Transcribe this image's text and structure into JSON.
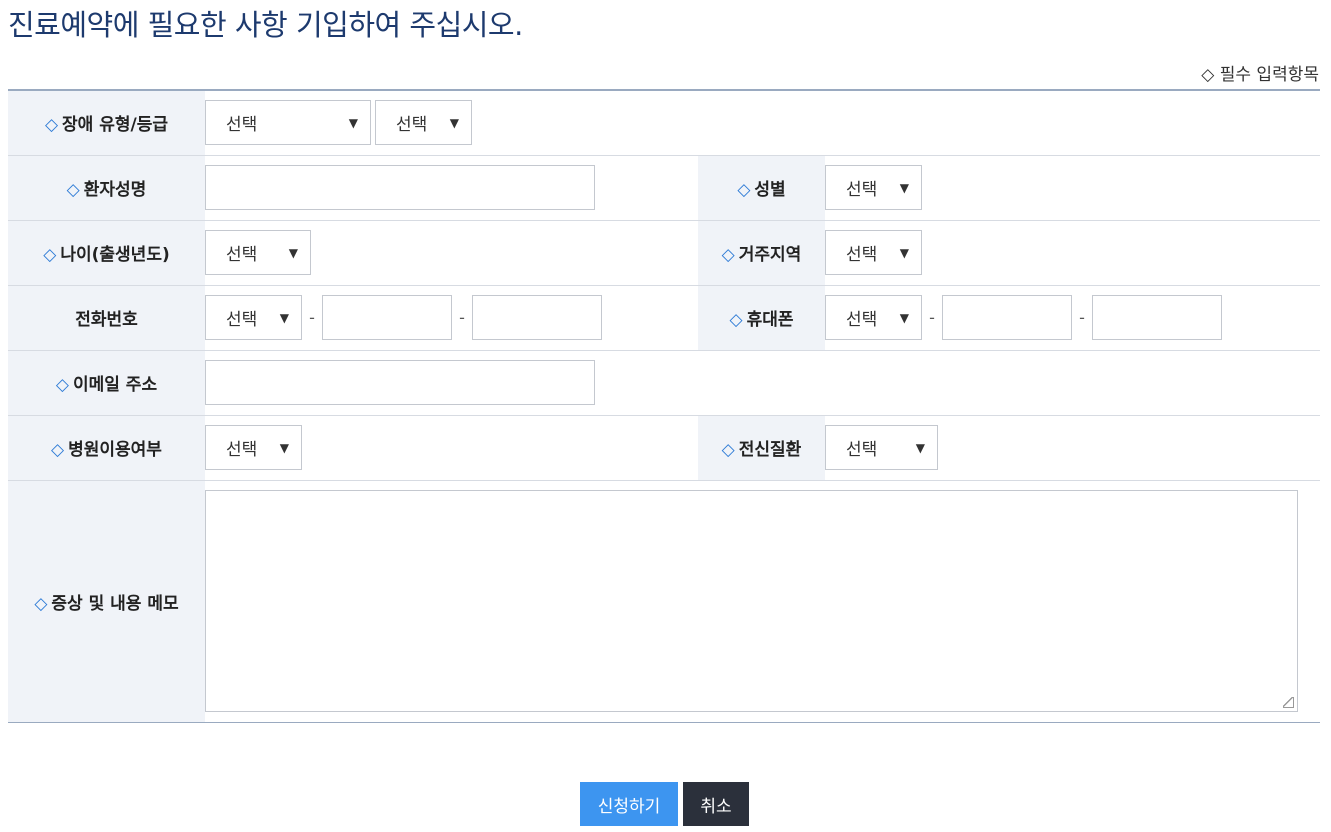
{
  "title": "진료예약에 필요한 사항 기입하여 주십시오.",
  "required_note": "◇ 필수 입력항목",
  "diamond": "◇",
  "labels": {
    "disability": "장애 유형/등급",
    "patient_name": "환자성명",
    "gender": "성별",
    "age": "나이(출생년도)",
    "region": "거주지역",
    "phone": "전화번호",
    "mobile": "휴대폰",
    "email": "이메일 주소",
    "hospital_use": "병원이용여부",
    "systemic_disease": "전신질환",
    "memo": "증상 및 내용 메모"
  },
  "select_default": "선택",
  "dash": "-",
  "buttons": {
    "submit": "신청하기",
    "cancel": "취소"
  },
  "colors": {
    "title": "#1d3a6e",
    "accent": "#2e7bd6",
    "submit_button": "#3d95f0",
    "cancel_button": "#2b303b",
    "label_background": "#f0f3f8"
  }
}
